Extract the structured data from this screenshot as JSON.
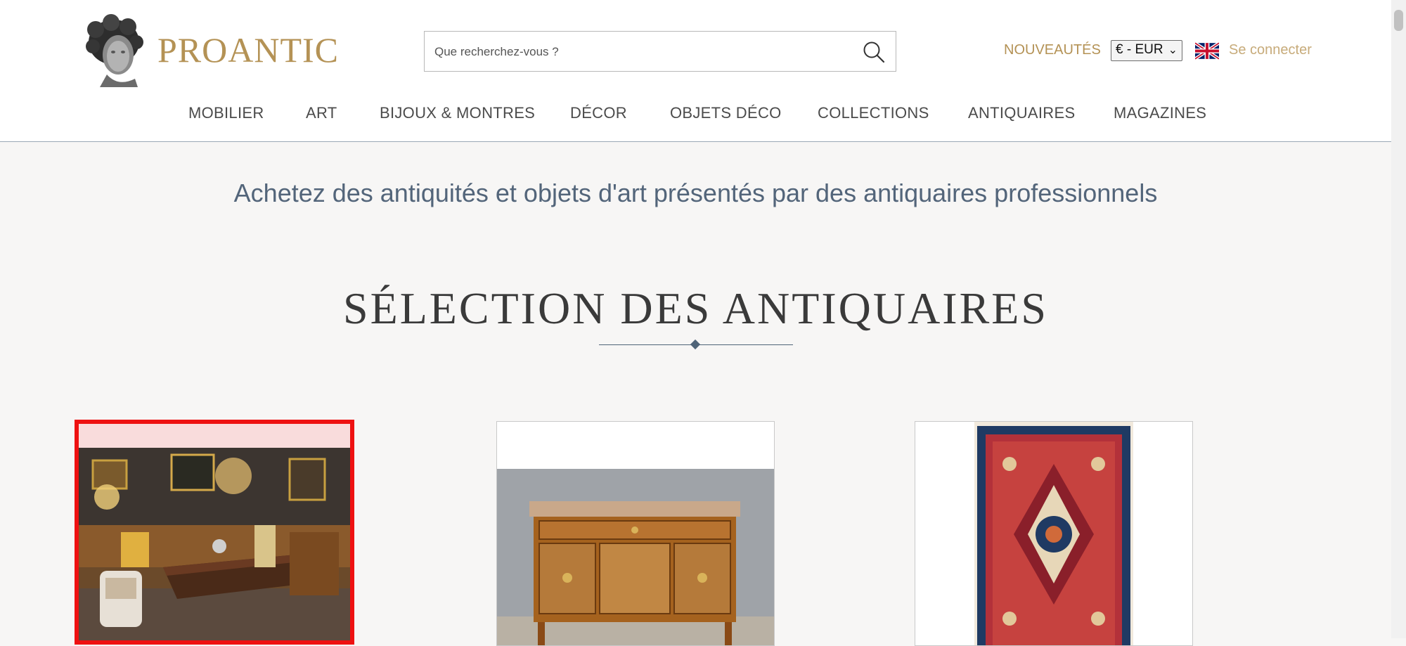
{
  "header": {
    "logo_text": "PROANTIC",
    "search": {
      "placeholder": "Que recherchez-vous ?",
      "value": ""
    },
    "nouveautes_label": "NOUVEAUTÉS",
    "currency_selected": "€ - EUR",
    "language_flag": "uk-flag-icon",
    "login_label": "Se connecter",
    "accent_color": "#b49255"
  },
  "nav": {
    "items": [
      {
        "label": "MOBILIER"
      },
      {
        "label": "ART"
      },
      {
        "label": "BIJOUX & MONTRES"
      },
      {
        "label": "DÉCOR"
      },
      {
        "label": "OBJETS DÉCO"
      },
      {
        "label": "COLLECTIONS"
      },
      {
        "label": "ANTIQUAIRES"
      },
      {
        "label": "MAGAZINES"
      }
    ]
  },
  "main": {
    "tagline": "Achetez des antiquités et objets d'art présentés par des antiquaires professionnels",
    "section_title": "SÉLECTION DES ANTIQUAIRES",
    "cards": [
      {
        "image": "antique-shop-interior-photo",
        "highlighted": true
      },
      {
        "image": "marquetry-commode-photo",
        "highlighted": false
      },
      {
        "image": "persian-rug-photo",
        "highlighted": false
      }
    ]
  }
}
